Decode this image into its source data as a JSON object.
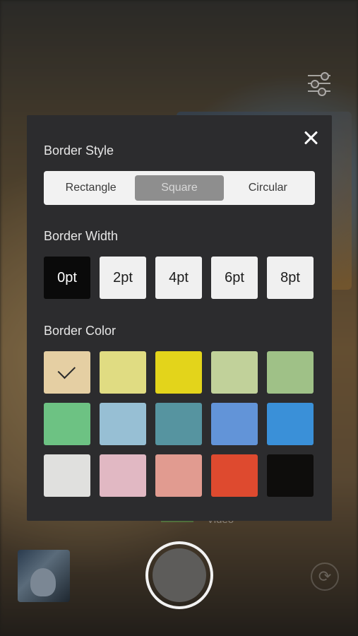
{
  "modal": {
    "border_style": {
      "title": "Border Style",
      "options": [
        "Rectangle",
        "Square",
        "Circular"
      ],
      "selected": "Square"
    },
    "border_width": {
      "title": "Border Width",
      "options": [
        "0pt",
        "2pt",
        "4pt",
        "6pt",
        "8pt"
      ],
      "selected": "0pt"
    },
    "border_color": {
      "title": "Border Color",
      "selected_index": 0,
      "colors": [
        "#e5cfa3",
        "#e0dc82",
        "#e3d41b",
        "#c1d19a",
        "#9fc187",
        "#6dc283",
        "#97bfd4",
        "#5694a0",
        "#6294d8",
        "#3a90d8",
        "#e0e0de",
        "#e1b8c3",
        "#e19b90",
        "#de4a2f",
        "#0e0d0c"
      ]
    }
  },
  "camera": {
    "mode_label": "Video"
  },
  "icons": {
    "close": "close-icon",
    "filters": "sliders-icon",
    "switch_camera": "camera-switch-icon",
    "check": "checkmark-icon"
  }
}
